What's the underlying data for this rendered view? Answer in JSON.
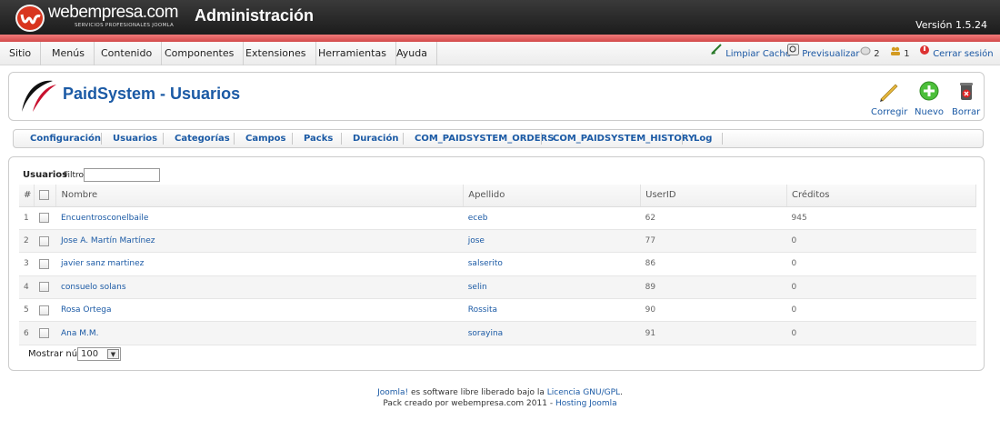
{
  "header": {
    "brand": "webempresa.com",
    "brand_sub": "SERVICIOS PROFESIONALES JOOMLA",
    "title": "Administración",
    "version": "Versión 1.5.24"
  },
  "menu": [
    "Sitio",
    "Menús",
    "Contenido",
    "Componentes",
    "Extensiones",
    "Herramientas",
    "Ayuda"
  ],
  "status": {
    "clear_cache": "Limpiar Caché",
    "preview": "Previsualizar",
    "messages": "2",
    "users_online": "1",
    "logout": "Cerrar sesión"
  },
  "toolbar": {
    "page_title": "PaidSystem - Usuarios",
    "edit": "Corregir",
    "new": "Nuevo",
    "delete": "Borrar"
  },
  "submenu": [
    "Configuración",
    "Usuarios",
    "Categorías",
    "Campos",
    "Packs",
    "Duración",
    "COM_PAIDSYSTEM_ORDERS",
    "COM_PAIDSYSTEM_HISTORY",
    "Log"
  ],
  "filter": {
    "label": "Usuarios",
    "sublabel": "Filtro",
    "value": ""
  },
  "table": {
    "headers": [
      "#",
      "",
      "Nombre",
      "Apellido",
      "UserID",
      "Créditos"
    ],
    "rows": [
      {
        "n": "1",
        "nombre": "Encuentrosconelbaile",
        "apellido": "eceb",
        "userid": "62",
        "creditos": "945"
      },
      {
        "n": "2",
        "nombre": "Jose A. Martín Martínez",
        "apellido": "jose",
        "userid": "77",
        "creditos": "0"
      },
      {
        "n": "3",
        "nombre": "javier sanz martinez",
        "apellido": "salserito",
        "userid": "86",
        "creditos": "0"
      },
      {
        "n": "4",
        "nombre": "consuelo solans",
        "apellido": "selin",
        "userid": "89",
        "creditos": "0"
      },
      {
        "n": "5",
        "nombre": "Rosa Ortega",
        "apellido": "Rossita",
        "userid": "90",
        "creditos": "0"
      },
      {
        "n": "6",
        "nombre": "Ana M.M.",
        "apellido": "sorayina",
        "userid": "91",
        "creditos": "0"
      }
    ]
  },
  "pagination": {
    "label": "Mostrar núm.",
    "value": "100"
  },
  "footer": {
    "line1_link1": "Joomla!",
    "line1_text": " es software libre liberado bajo la ",
    "line1_link2": "Licencia GNU/GPL",
    "line1_end": ".",
    "line2_text": "Pack creado por webempresa.com 2011 - ",
    "line2_link": "Hosting Joomla"
  },
  "colors": {
    "link": "#1b5aa5",
    "header_bg": "#2a2a2a",
    "red_band": "#e05a5a"
  }
}
